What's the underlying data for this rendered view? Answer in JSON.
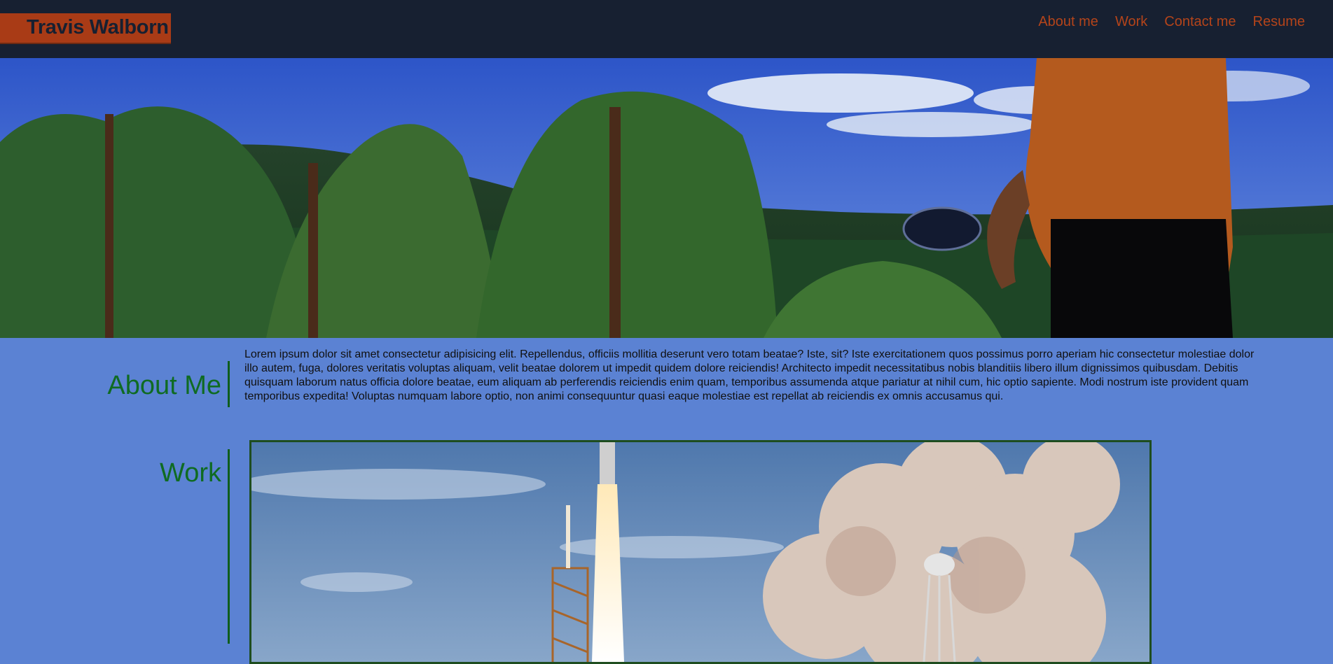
{
  "header": {
    "brand": "Travis Walborn",
    "nav": [
      {
        "label": "About me"
      },
      {
        "label": "Work"
      },
      {
        "label": "Contact me"
      },
      {
        "label": "Resume"
      }
    ]
  },
  "about": {
    "title": "About Me",
    "text": "Lorem ipsum dolor sit amet consectetur adipisicing elit. Repellendus, officiis mollitia deserunt vero totam beatae? Iste, sit? Iste exercitationem quos possimus porro aperiam hic consectetur molestiae dolor illo autem, fuga, dolores veritatis voluptas aliquam, velit beatae dolorem ut impedit quidem dolore reiciendis! Architecto impedit necessitatibus nobis blanditiis libero illum dignissimos quibusdam. Debitis quisquam laborum natus officia dolore beatae, eum aliquam ab perferendis reiciendis enim quam, temporibus assumenda atque pariatur at nihil cum, hic optio sapiente. Modi nostrum iste provident quam temporibus expedita! Voluptas numquam labore optio, non animi consequuntur quasi eaque molestiae est repellat ab reiciendis ex omnis accusamus qui."
  },
  "work": {
    "title": "Work"
  },
  "colors": {
    "header_bg": "#172031",
    "brand_bg": "#a93b16",
    "nav_link": "#b4441a",
    "page_bg": "#5b82d3",
    "section_title": "#0f6b22"
  }
}
